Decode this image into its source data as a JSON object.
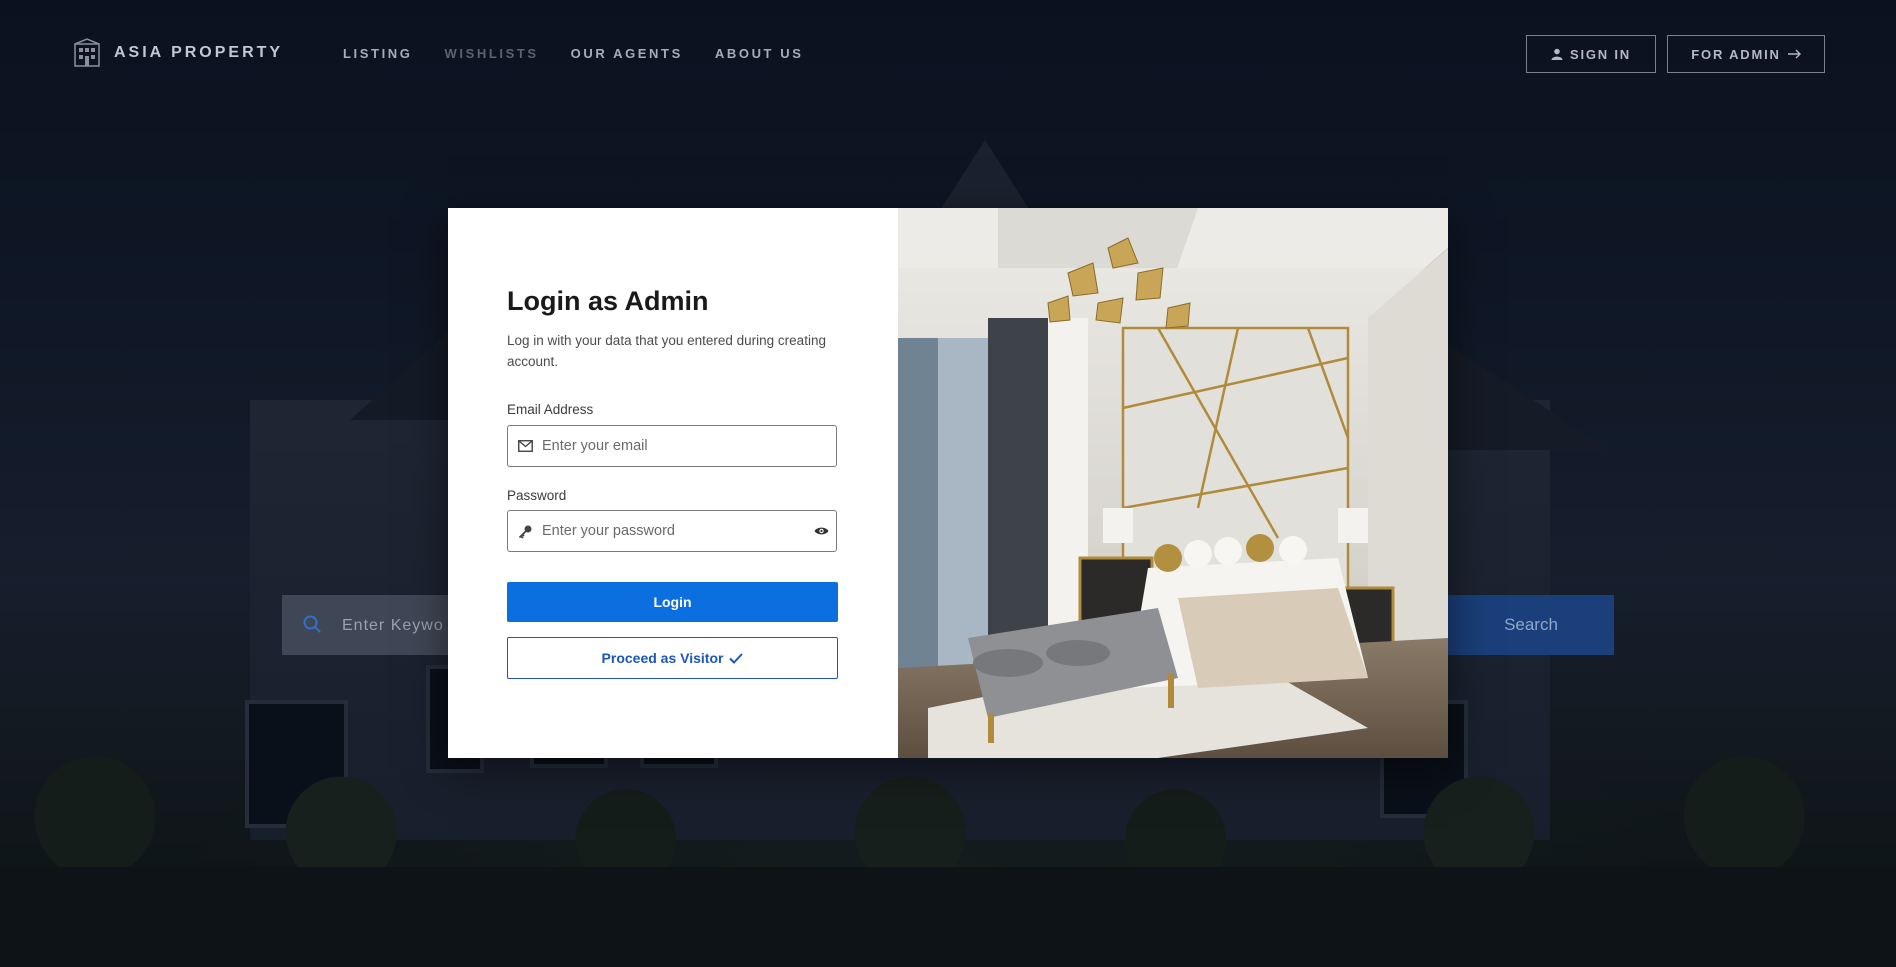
{
  "brand": {
    "name": "ASIA PROPERTY",
    "logo_icon": "building-icon"
  },
  "nav": {
    "links": [
      {
        "label": "LISTING",
        "muted": false
      },
      {
        "label": "WISHLISTS",
        "muted": true
      },
      {
        "label": "OUR AGENTS",
        "muted": false
      },
      {
        "label": "ABOUT US",
        "muted": false
      }
    ],
    "sign_in": {
      "label": "SIGN IN",
      "icon": "user-icon"
    },
    "for_admin": {
      "label": "FOR ADMIN",
      "icon": "arrow-right-icon"
    }
  },
  "search": {
    "placeholder": "Enter Keyword",
    "button_label": "Search",
    "icon": "search-icon"
  },
  "modal": {
    "title": "Login as Admin",
    "description": "Log in with your data that you entered during creating account.",
    "email": {
      "label": "Email Address",
      "placeholder": "Enter your email",
      "icon": "envelope-icon",
      "value": ""
    },
    "password": {
      "label": "Password",
      "placeholder": "Enter your password",
      "icon": "key-icon",
      "toggle_icon": "eye-icon",
      "value": ""
    },
    "login_label": "Login",
    "visitor_label": "Proceed as Visitor",
    "visitor_icon": "check-icon",
    "image": "bedroom-interior-image"
  },
  "colors": {
    "primary": "#0b6fe0",
    "outline": "#1c57b8",
    "nav_text": "#a7adb8"
  }
}
